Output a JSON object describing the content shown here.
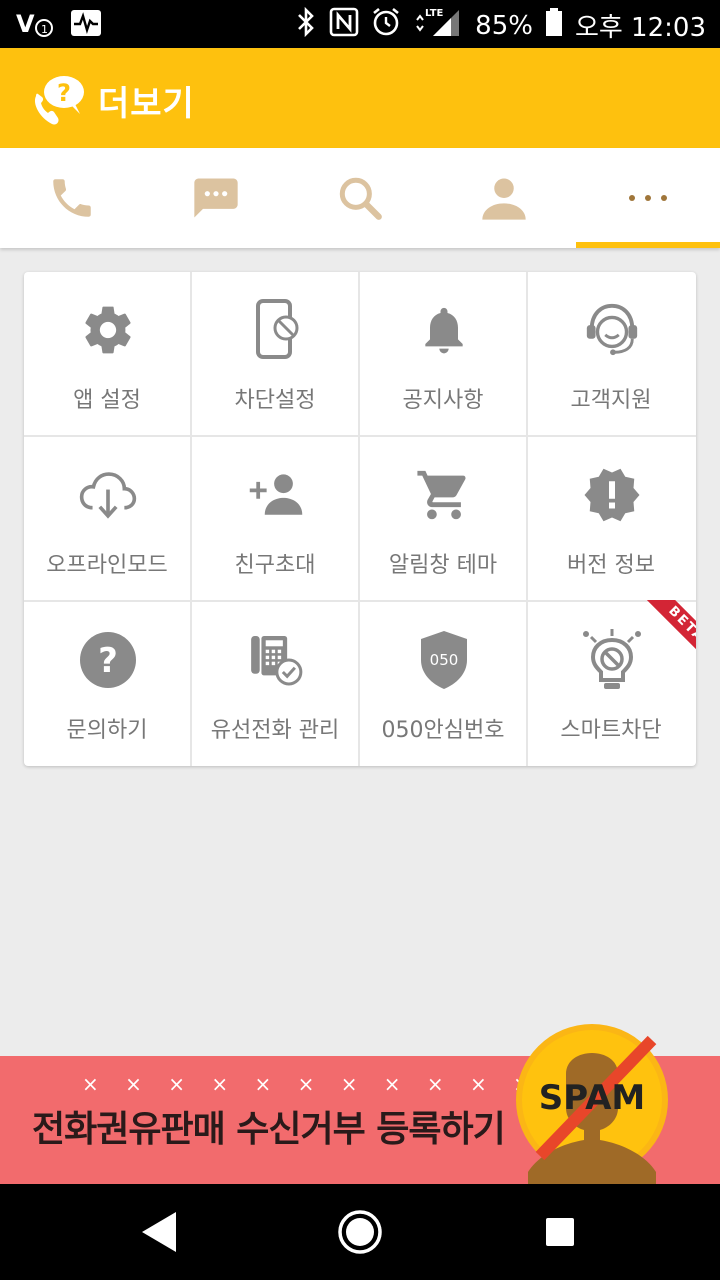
{
  "status_bar": {
    "battery": "85%",
    "time": "오후 12:03",
    "network": "LTE"
  },
  "app_bar": {
    "title": "더보기"
  },
  "tabs": [
    {
      "name": "phone-icon"
    },
    {
      "name": "message-icon"
    },
    {
      "name": "search-icon"
    },
    {
      "name": "person-icon"
    },
    {
      "name": "more-icon",
      "selected": true
    }
  ],
  "menu": {
    "items": [
      {
        "label": "앱 설정",
        "icon": "gear-icon"
      },
      {
        "label": "차단설정",
        "icon": "phone-block-icon"
      },
      {
        "label": "공지사항",
        "icon": "bell-icon"
      },
      {
        "label": "고객지원",
        "icon": "headset-icon"
      },
      {
        "label": "오프라인모드",
        "icon": "cloud-download-icon"
      },
      {
        "label": "친구초대",
        "icon": "add-person-icon"
      },
      {
        "label": "알림창 테마",
        "icon": "cart-icon"
      },
      {
        "label": "버전 정보",
        "icon": "info-badge-icon"
      },
      {
        "label": "문의하기",
        "icon": "help-icon"
      },
      {
        "label": "유선전화 관리",
        "icon": "landline-phone-icon"
      },
      {
        "label": "050안심번호",
        "icon": "shield-050-icon"
      },
      {
        "label": "스마트차단",
        "icon": "smart-block-bulb-icon"
      }
    ],
    "beta_badge": "BETA",
    "shield_text": "050"
  },
  "banner": {
    "text": "전화권유판매 수신거부 등록하기",
    "crosses": "× × × × × × × × × × × ×",
    "spam_label": "SPAM"
  },
  "colors": {
    "accent": "#fec10e",
    "tab_icon": "#dcc3a0",
    "menu_icon": "#8a8a8a",
    "banner": "#f26b6d",
    "beta": "#d32535"
  }
}
